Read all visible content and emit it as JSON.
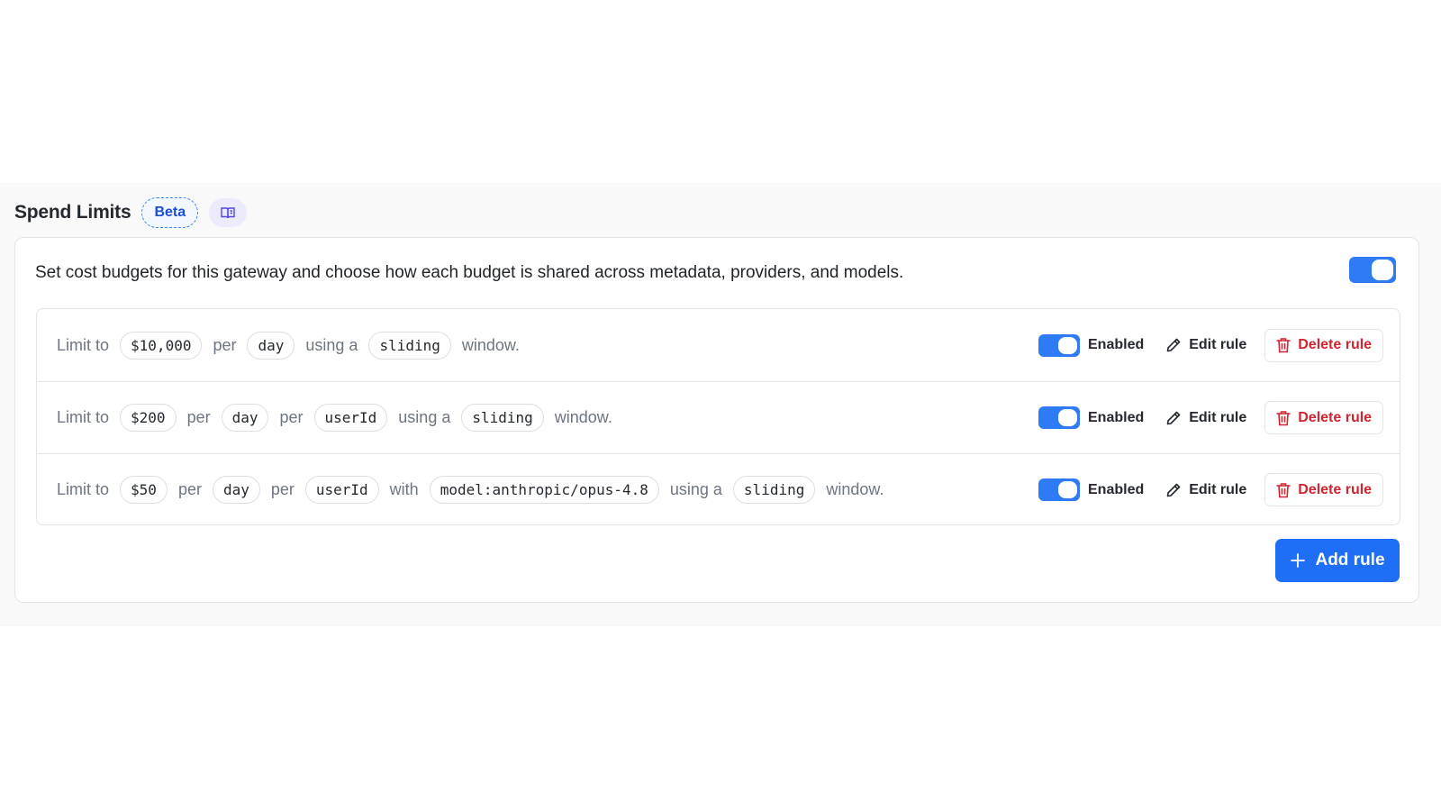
{
  "header": {
    "title": "Spend Limits",
    "badge": "Beta",
    "docs_icon": "book-icon"
  },
  "card": {
    "description": "Set cost budgets for this gateway and choose how each budget is shared across metadata, providers, and models.",
    "master_toggle_on": true
  },
  "rules": [
    {
      "enabled": true,
      "segments": [
        {
          "t": "text",
          "v": "Limit to"
        },
        {
          "t": "chip",
          "v": "$10,000"
        },
        {
          "t": "text",
          "v": "per"
        },
        {
          "t": "chip",
          "v": "day"
        },
        {
          "t": "text",
          "v": "using a"
        },
        {
          "t": "chip",
          "v": "sliding"
        },
        {
          "t": "text",
          "v": "window."
        }
      ]
    },
    {
      "enabled": true,
      "segments": [
        {
          "t": "text",
          "v": "Limit to"
        },
        {
          "t": "chip",
          "v": "$200"
        },
        {
          "t": "text",
          "v": "per"
        },
        {
          "t": "chip",
          "v": "day"
        },
        {
          "t": "text",
          "v": "per"
        },
        {
          "t": "chip",
          "v": "userId"
        },
        {
          "t": "text",
          "v": "using a"
        },
        {
          "t": "chip",
          "v": "sliding"
        },
        {
          "t": "text",
          "v": "window."
        }
      ]
    },
    {
      "enabled": true,
      "segments": [
        {
          "t": "text",
          "v": "Limit to"
        },
        {
          "t": "chip",
          "v": "$50"
        },
        {
          "t": "text",
          "v": "per"
        },
        {
          "t": "chip",
          "v": "day"
        },
        {
          "t": "text",
          "v": "per"
        },
        {
          "t": "chip",
          "v": "userId"
        },
        {
          "t": "text",
          "v": "with"
        },
        {
          "t": "chip",
          "v": "model:anthropic/opus-4.8"
        },
        {
          "t": "text",
          "v": "using a"
        },
        {
          "t": "chip",
          "v": "sliding"
        },
        {
          "t": "text",
          "v": "window."
        }
      ]
    }
  ],
  "labels": {
    "enabled": "Enabled",
    "edit": "Edit rule",
    "delete": "Delete rule",
    "add": "Add rule"
  },
  "colors": {
    "accent": "#2f7bf6",
    "primary_button": "#1e6ff5",
    "danger": "#d1242f",
    "beta_border": "#3b82f6"
  }
}
